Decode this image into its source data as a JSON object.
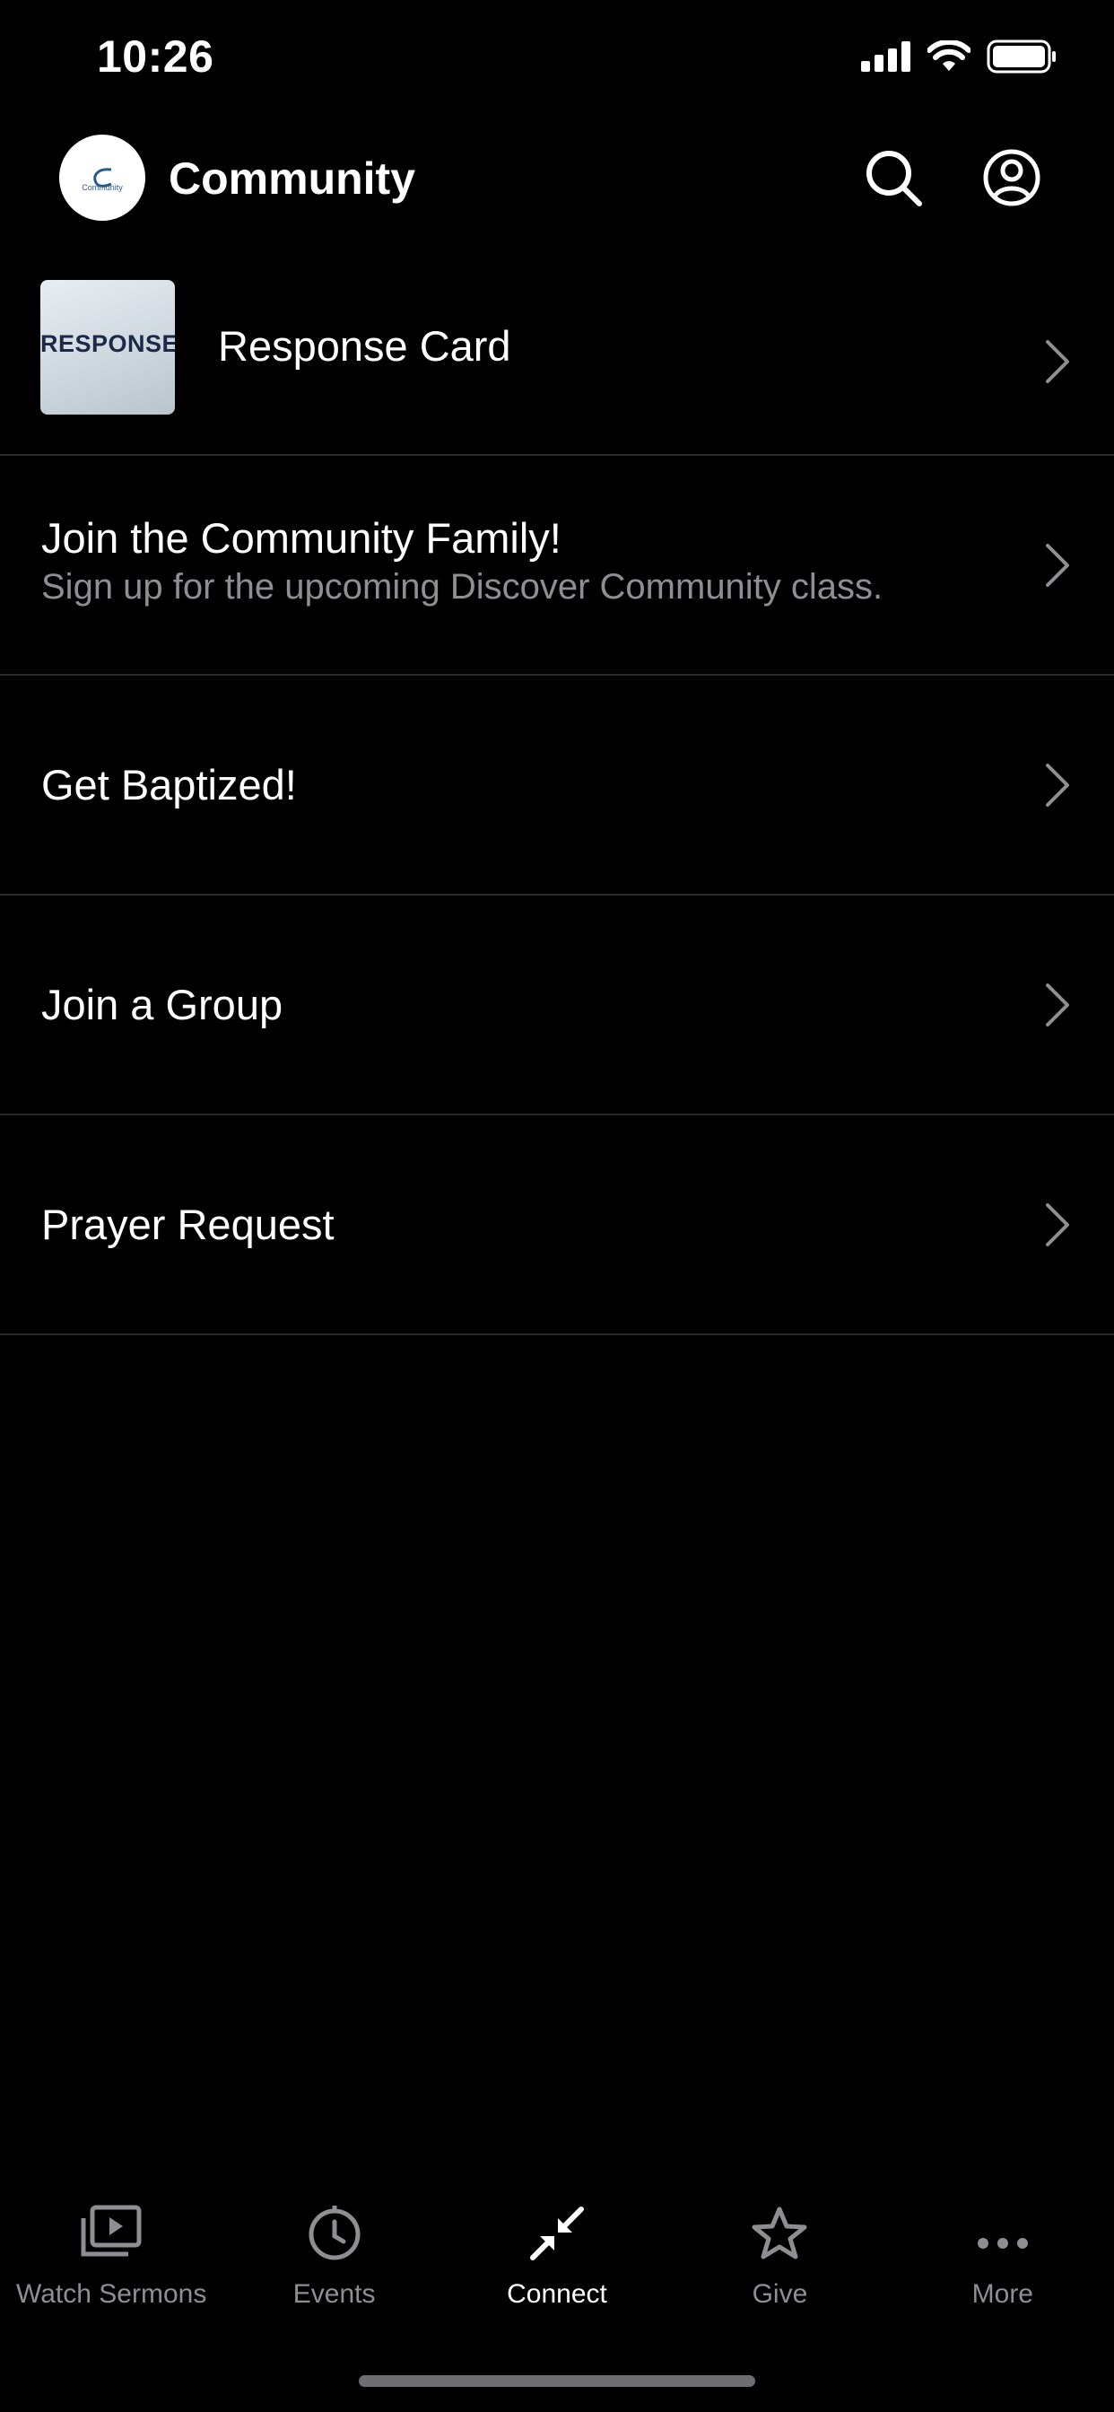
{
  "status_bar": {
    "time": "10:26"
  },
  "header": {
    "logo_text": "Community",
    "title": "Community",
    "search_icon": "search-icon",
    "profile_icon": "user-circle-icon"
  },
  "list": [
    {
      "title": "Response Card",
      "thumbnail_text": "RESPONSE"
    },
    {
      "title": "Join the Community Family!",
      "subtitle": "Sign up for the upcoming Discover Community class."
    },
    {
      "title": "Get Baptized!"
    },
    {
      "title": "Join a Group"
    },
    {
      "title": "Prayer Request"
    }
  ],
  "tabs": [
    {
      "label": "Watch Sermons",
      "icon": "video-library-icon"
    },
    {
      "label": "Events",
      "icon": "clock-icon"
    },
    {
      "label": "Connect",
      "icon": "connect-arrows-icon",
      "active": true
    },
    {
      "label": "Give",
      "icon": "star-icon"
    },
    {
      "label": "More",
      "icon": "more-dots-icon"
    }
  ],
  "colors": {
    "background": "#000000",
    "text": "#ffffff",
    "secondary": "#8e8e93",
    "separator": "#2a2a2a"
  }
}
